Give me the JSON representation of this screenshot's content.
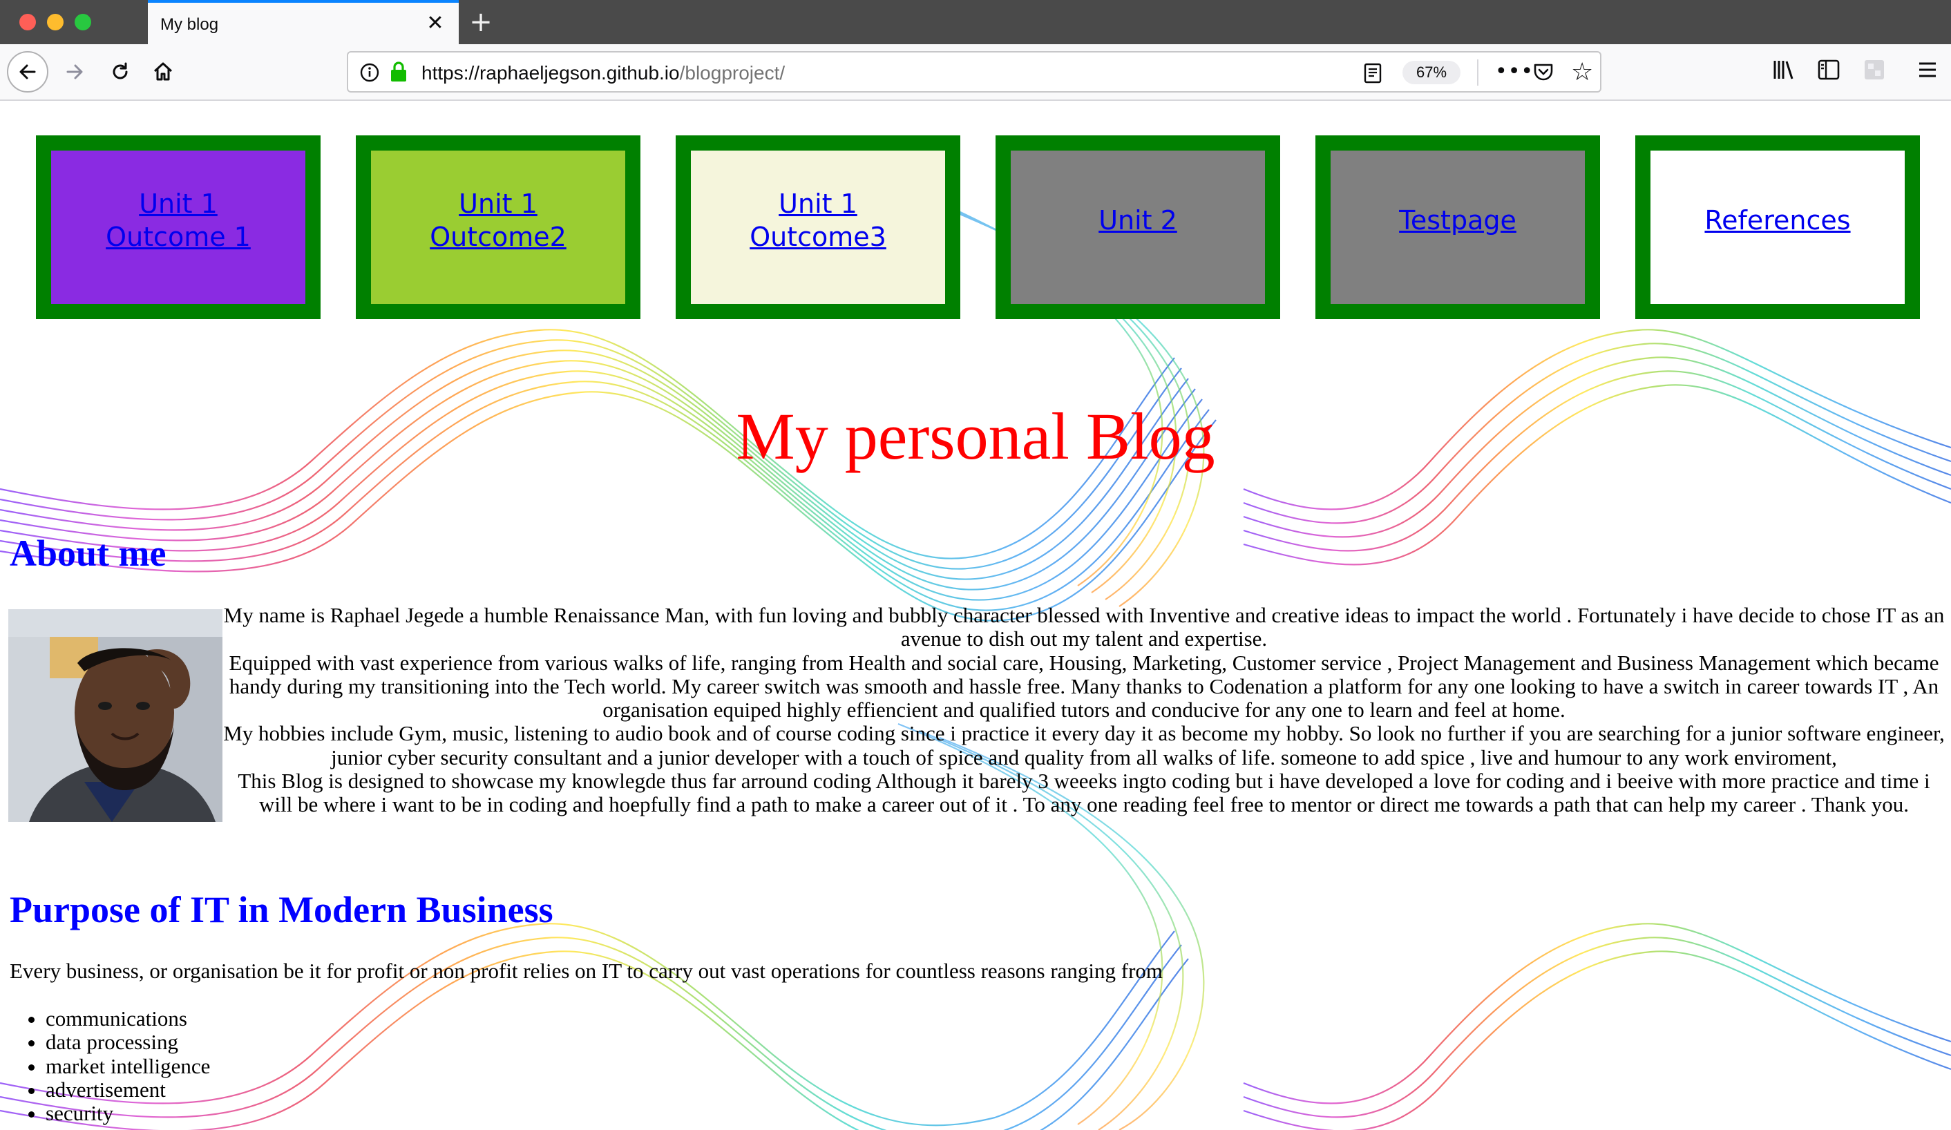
{
  "browser": {
    "tab_title": "My blog",
    "tab_close": "✕",
    "new_tab": "+",
    "url_host": "https://raphaeljegson.github.io",
    "url_path": "/blogproject/",
    "zoom": "67%",
    "more": "•••",
    "star": "☆"
  },
  "nav": [
    {
      "line1": "Unit 1",
      "line2": "Outcome 1",
      "bg": "#8a2be2"
    },
    {
      "line1": "Unit 1",
      "line2": "Outcome2",
      "bg": "#9acd32"
    },
    {
      "line1": "Unit 1",
      "line2": "Outcome3",
      "bg": "#f5f5dc"
    },
    {
      "line1": "Unit 2",
      "line2": "",
      "bg": "#808080"
    },
    {
      "line1": "Testpage",
      "line2": "",
      "bg": "#808080"
    },
    {
      "line1": "References",
      "line2": "",
      "bg": "#ffffff"
    }
  ],
  "page": {
    "title": "My personal Blog",
    "about_heading": "About me",
    "bio": [
      "My name is Raphael Jegede a humble Renaissance Man, with fun loving and bubbly character blessed with Inventive and creative ideas to impact the world . Fortunately i have decide to chose IT as an avenue to dish out my talent and expertise.",
      "Equipped with vast experience from various walks of life, ranging from Health and social care, Housing, Marketing, Customer service , Project Management and Business Management which became handy during my transitioning into the Tech world. My career switch was smooth and hassle free. Many thanks to Codenation a platform for any one looking to have a switch in career towards IT , An organisation equiped highly effiencient and qualified tutors and conducive for any one to learn and feel at home.",
      "My hobbies include Gym, music, listening to audio book and of course coding since i practice it every day it as become my hobby. So look no further if you are searching for a junior software engineer, junior cyber security consultant and a junior developer with a touch of spice and quality from all walks of life. someone to add spice , live and humour to any work enviroment,",
      "This Blog is designed to showcase my knowlegde thus far arround coding Although it barely 3 weeeks ingto coding but i have developed a love for coding and i beeive with more practice and time i will be where i want to be in coding and hoepfully find a path to make a career out of it . To any one reading feel free to mentor or direct me towards a path that can help my career . Thank you."
    ],
    "purpose_heading": "Purpose of IT in Modern Business",
    "purpose_text": "Every business, or organisation be it for profit or non profit relies on IT to carry out vast operations for countless reasons ranging from",
    "purpose_list": [
      "communications",
      "data processing",
      "market intelligence",
      "advertisement",
      "security"
    ]
  }
}
